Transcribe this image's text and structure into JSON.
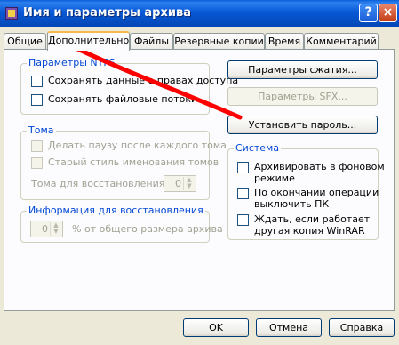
{
  "window": {
    "title": "Имя и параметры архива",
    "help_label": "?",
    "close_label": "×"
  },
  "tabs": [
    "Общие",
    "Дополнительно",
    "Файлы",
    "Резервные копии",
    "Время",
    "Комментарий"
  ],
  "ntfs": {
    "title": "Параметры NTFS",
    "items": [
      {
        "label": "Сохранять данные о правах доступа",
        "checked": false
      },
      {
        "label": "Сохранять файловые потоки",
        "checked": false
      }
    ]
  },
  "volumes": {
    "title": "Тома",
    "items": [
      {
        "label": "Делать паузу после каждого тома",
        "checked": false
      },
      {
        "label": "Старый стиль именования томов",
        "checked": false
      }
    ],
    "recovery_label": "Тома для восстановления:",
    "recovery_value": "0"
  },
  "recovery": {
    "title": "Информация для восстановления",
    "value": "0",
    "suffix": "% от общего размера архива"
  },
  "buttons": {
    "compression": "Параметры сжатия...",
    "sfx": "Параметры SFX...",
    "password": "Установить пароль..."
  },
  "system": {
    "title": "Система",
    "items": [
      {
        "lines": [
          "Архивировать в фоновом",
          "режиме"
        ]
      },
      {
        "lines": [
          "По окончании операции",
          "выключить ПК"
        ]
      },
      {
        "lines": [
          "Ждать, если работает",
          "другая копия WinRAR"
        ]
      }
    ]
  },
  "footer": {
    "ok": "OK",
    "cancel": "Отмена",
    "help": "Справка"
  },
  "colors": {
    "annotation": "#ff0000",
    "group_label": "#0046d5",
    "title_bar": "#0858d6"
  }
}
